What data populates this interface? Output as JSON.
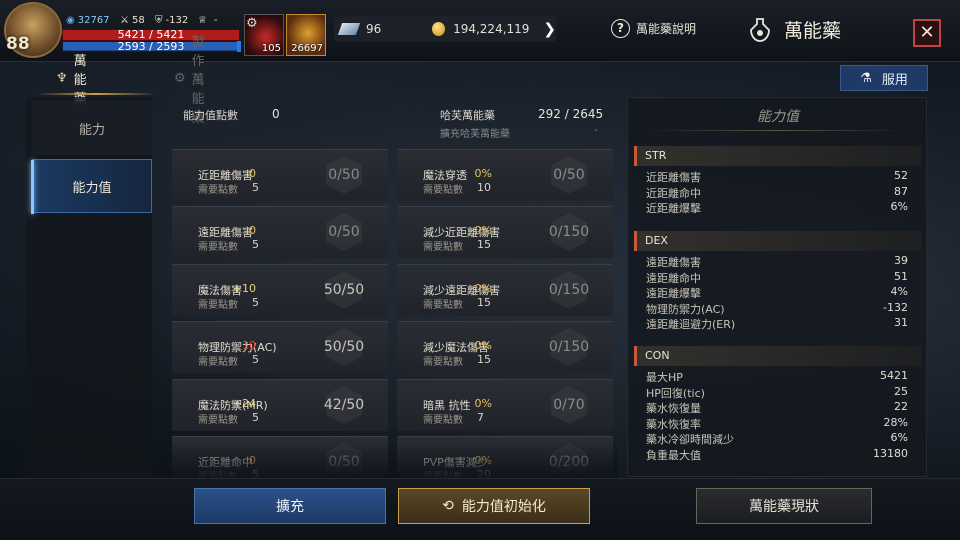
{
  "player": {
    "level": "88",
    "pvp_points": "32767",
    "stat_a": "58",
    "stat_b": "-132",
    "stat_c": "-",
    "hp": "5421 / 5421",
    "mp": "2593 / 2593"
  },
  "quick_items": [
    {
      "icon": "red-potion-icon",
      "count": "105"
    },
    {
      "icon": "elixir-potion-icon",
      "count": "26697"
    }
  ],
  "currencies": {
    "gems": "96",
    "gold": "194,224,119"
  },
  "header": {
    "help_label": "萬能藥說明",
    "title": "萬能藥",
    "close_icon": "close-icon"
  },
  "tabs": [
    {
      "label": "萬能藥",
      "active": true
    },
    {
      "label": "製作萬能藥",
      "active": false
    }
  ],
  "use_button": "服用",
  "sidenav": [
    "能力",
    "能力值"
  ],
  "summary": {
    "points_label": "能力值點數",
    "points_value": "0",
    "elixir_label": "哈芙萬能藥",
    "elixir_value": "292 / 2645",
    "elixir_sub_label": "擴充哈芙萬能藥",
    "elixir_sub_value": "-"
  },
  "need_label": "需要點數",
  "stats_left": [
    {
      "name": "近距離傷害",
      "need": "5",
      "bonus": "0",
      "progress": "0/50"
    },
    {
      "name": "遠距離傷害",
      "need": "5",
      "bonus": "0",
      "progress": "0/50"
    },
    {
      "name": "魔法傷害",
      "need": "5",
      "bonus": "+10",
      "progress": "50/50"
    },
    {
      "name": "物理防禦力(AC)",
      "need": "5",
      "bonus": "-10",
      "progress": "50/50"
    },
    {
      "name": "魔法防禦(MR)",
      "need": "5",
      "bonus": "+24",
      "progress": "42/50"
    },
    {
      "name": "近距離命中",
      "need": "5",
      "bonus": "0",
      "progress": "0/50"
    }
  ],
  "stats_right": [
    {
      "name": "魔法穿透",
      "need": "10",
      "bonus": "0%",
      "progress": "0/50"
    },
    {
      "name": "減少近距離傷害",
      "need": "15",
      "bonus": "0%",
      "progress": "0/150"
    },
    {
      "name": "減少遠距離傷害",
      "need": "15",
      "bonus": "0%",
      "progress": "0/150"
    },
    {
      "name": "減少魔法傷害",
      "need": "15",
      "bonus": "0%",
      "progress": "0/150"
    },
    {
      "name": "暗黑 抗性",
      "need": "7",
      "bonus": "0%",
      "progress": "0/70"
    },
    {
      "name": "PVP傷害減少",
      "need": "20",
      "bonus": "0%",
      "progress": "0/200"
    }
  ],
  "panel": {
    "title": "能力值",
    "sections": [
      {
        "head": "STR",
        "rows": [
          {
            "k": "近距離傷害",
            "v": "52"
          },
          {
            "k": "近距離命中",
            "v": "87"
          },
          {
            "k": "近距離爆擊",
            "v": "6%"
          }
        ]
      },
      {
        "head": "DEX",
        "rows": [
          {
            "k": "遠距離傷害",
            "v": "39"
          },
          {
            "k": "遠距離命中",
            "v": "51"
          },
          {
            "k": "遠距離爆擊",
            "v": "4%"
          },
          {
            "k": "物理防禦力(AC)",
            "v": "-132"
          },
          {
            "k": "遠距離迴避力(ER)",
            "v": "31"
          }
        ]
      },
      {
        "head": "CON",
        "rows": [
          {
            "k": "最大HP",
            "v": "5421"
          },
          {
            "k": "HP回復(tic)",
            "v": "25"
          },
          {
            "k": "藥水恢復量",
            "v": "22"
          },
          {
            "k": "藥水恢復率",
            "v": "28%"
          },
          {
            "k": "藥水冷卻時間減少",
            "v": "6%"
          },
          {
            "k": "負重最大值",
            "v": "13180"
          }
        ]
      }
    ]
  },
  "bottom": {
    "expand": "擴充",
    "reset": "能力值初始化",
    "status": "萬能藥現狀"
  },
  "colors": {
    "positive": "#e8d28a",
    "negative": "#e84a3a",
    "zero": "#e8c060",
    "accent_blue": "#1f3a66",
    "accent_gold": "#c9a04a"
  }
}
